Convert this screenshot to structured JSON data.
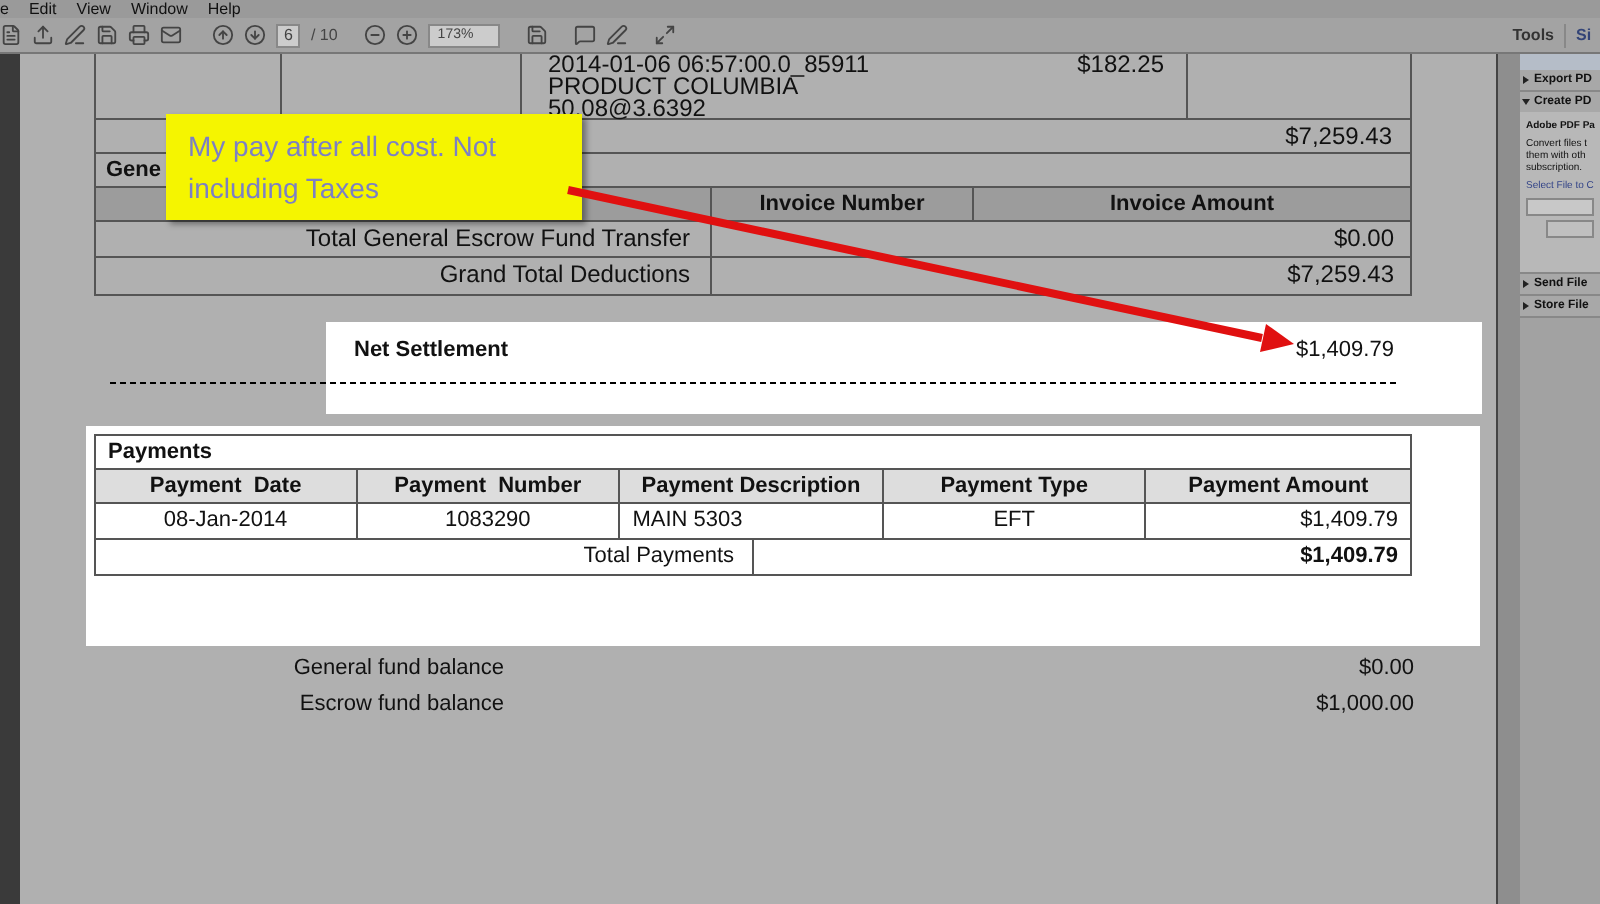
{
  "menu_bar": [
    "e",
    "Edit",
    "View",
    "Window",
    "Help"
  ],
  "toolbar": {
    "page": "6",
    "page_count": "/ 10",
    "zoom": "173%"
  },
  "side_panel": {
    "tabs": [
      "Tools",
      "Si"
    ],
    "sections": [
      {
        "title": "Export PD",
        "expanded": false
      },
      {
        "title": "Create PD",
        "expanded": true,
        "heading": "Adobe PDF Pa",
        "lines": [
          "Convert files t",
          "them with oth",
          "subscription."
        ],
        "link": "Select File to C"
      },
      {
        "title": "Send File",
        "expanded": false
      },
      {
        "title": "Store File",
        "expanded": false
      }
    ]
  },
  "statement": {
    "item_row": {
      "details": [
        "2014-01-06 06:57:00.0_85911",
        "PRODUCT COLUMBIA",
        "50.08@3.6392"
      ],
      "amount": "$182.25"
    },
    "subtotal": "$7,259.43",
    "section_title": "Gene",
    "invoice_columns": [
      "Invoice Number",
      "Invoice Amount"
    ],
    "deductions": [
      {
        "label": "Total General Escrow Fund Transfer",
        "amount": "$0.00"
      },
      {
        "label": "Grand Total Deductions",
        "amount": "$7,259.43"
      }
    ],
    "net_settlement": {
      "label": "Net Settlement",
      "amount": "$1,409.79"
    },
    "payments": {
      "title": "Payments",
      "columns": [
        "Payment  Date",
        "Payment  Number",
        "Payment Description",
        "Payment Type",
        "Payment Amount"
      ],
      "rows": [
        [
          "08-Jan-2014",
          "1083290",
          "MAIN 5303",
          "EFT",
          "$1,409.79"
        ]
      ],
      "total_label": "Total Payments",
      "total": "$1,409.79"
    },
    "balances": [
      {
        "label": "General fund balance",
        "amount": "$0.00"
      },
      {
        "label": "Escrow fund balance",
        "amount": "$1,000.00"
      }
    ]
  },
  "callout": {
    "text": "My pay after all cost. Not including Taxes"
  }
}
